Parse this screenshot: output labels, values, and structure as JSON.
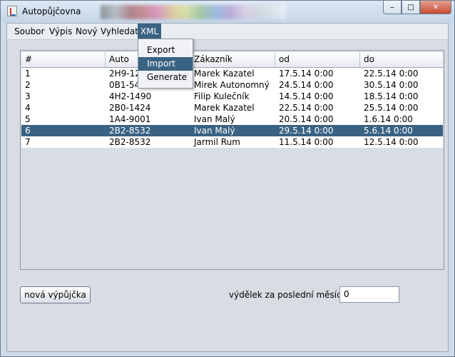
{
  "window": {
    "title": "Autopůjčovna",
    "controls": {
      "minimize": "‒",
      "maximize": "□",
      "close": "✕"
    }
  },
  "menubar": {
    "items": [
      {
        "label": "Soubor"
      },
      {
        "label": "Výpis"
      },
      {
        "label": "Nový"
      },
      {
        "label": "Vyhledat"
      },
      {
        "label": "XML",
        "active": true
      }
    ]
  },
  "xml_menu": {
    "items": [
      {
        "label": "Export"
      },
      {
        "label": "Import",
        "active": true
      },
      {
        "label": "Generate"
      }
    ]
  },
  "table": {
    "columns": [
      "#",
      "Auto",
      "Zákazník",
      "od",
      "do"
    ],
    "rows": [
      [
        "1",
        "2H9-12..",
        "Marek Kazatel",
        "17.5.14 0:00",
        "22.5.14 0:00"
      ],
      [
        "2",
        "0B1-54..",
        "Mirek Autonomný",
        "24.5.14 0:00",
        "30.5.14 0:00"
      ],
      [
        "3",
        "4H2-1490",
        "Filip Kulečník",
        "14.5.14 0:00",
        "18.5.14 0:00"
      ],
      [
        "4",
        "2B0-1424",
        "Marek Kazatel",
        "22.5.14 0:00",
        "25.5.14 0:00"
      ],
      [
        "5",
        "1A4-9001",
        "Ivan Malý",
        "20.5.14 0:00",
        "1.6.14 0:00"
      ],
      [
        "6",
        "2B2-8532",
        "Ivan Malý",
        "29.5.14 0:00",
        "5.6.14 0:00"
      ],
      [
        "7",
        "2B2-8532",
        "Jarmil Rum",
        "11.5.14 0:00",
        "12.5.14 0:00"
      ]
    ],
    "selected_row_index": 5
  },
  "footer": {
    "new_rental_button": "nová výpůjčka",
    "earnings_label": "výdělek za poslední měsíc:",
    "earnings_value": "0"
  },
  "colors": {
    "selection": "#3a6283",
    "window_frame": "#cfdbe8",
    "client_bg": "#d8dce3"
  }
}
